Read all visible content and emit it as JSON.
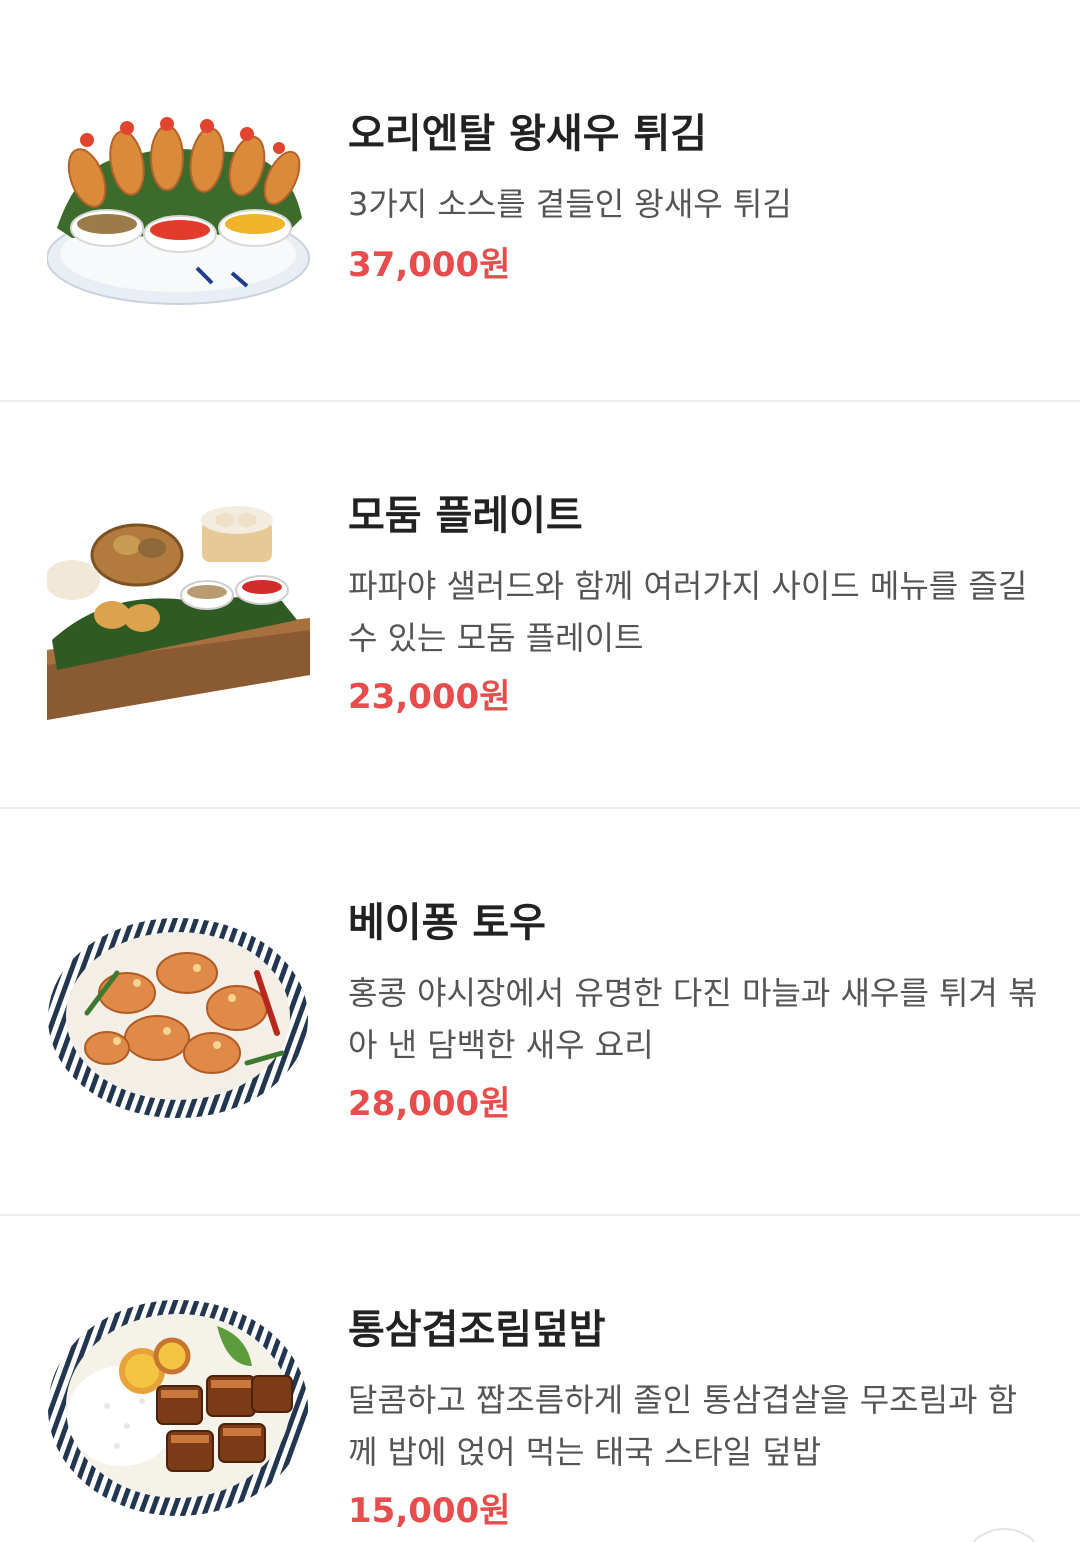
{
  "menu": {
    "items": [
      {
        "name": "오리엔탈 왕새우 튀김",
        "description": "3가지 소스를 곁들인 왕새우 튀김",
        "price": "37,000원",
        "image": "fried-shrimp-platter-image"
      },
      {
        "name": "모둠 플레이트",
        "description": "파파야 샐러드와 함께 여러가지 사이드 메뉴를 즐길 수 있는 모둠 플레이트",
        "price": "23,000원",
        "image": "assorted-plate-image"
      },
      {
        "name": "베이퐁 토우",
        "description": "홍콩 야시장에서 유명한 다진 마늘과 새우를 튀겨 볶아 낸 담백한 새우 요리",
        "price": "28,000원",
        "image": "garlic-shrimp-bowl-image"
      },
      {
        "name": "통삼겹조림덮밥",
        "description": "달콤하고 짭조름하게 졸인 통삼겹살을 무조림과 함께 밥에 얹어 먹는 태국 스타일 덮밥",
        "price": "15,000원",
        "image": "braised-pork-rice-bowl-image"
      }
    ]
  },
  "colors": {
    "price": "#e84c4c",
    "title": "#222222",
    "description": "#555555",
    "divider": "#eeeeee"
  }
}
